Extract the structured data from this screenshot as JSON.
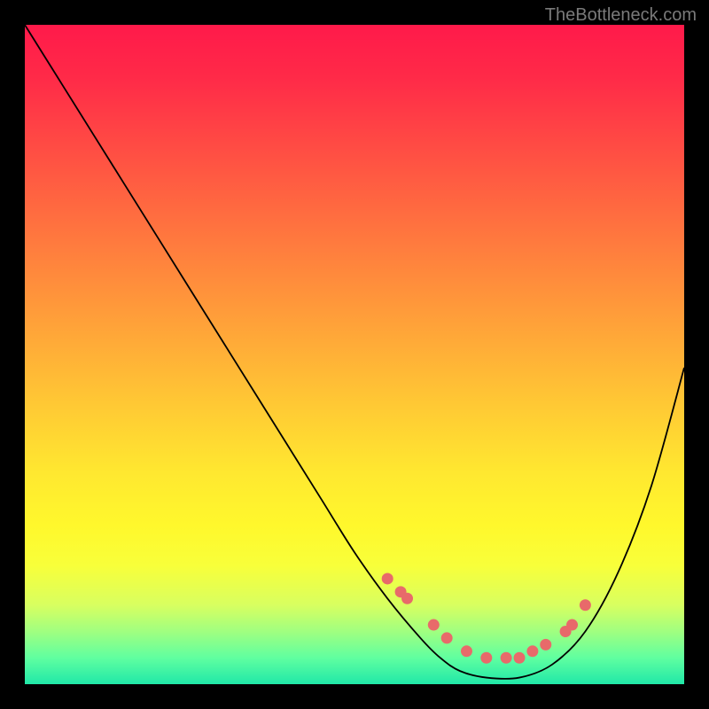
{
  "watermark": "TheBottleneck.com",
  "chart_data": {
    "type": "line",
    "title": "",
    "xlabel": "",
    "ylabel": "",
    "xlim": [
      0,
      100
    ],
    "ylim": [
      0,
      100
    ],
    "series": [
      {
        "name": "bottleneck-curve",
        "x": [
          0,
          5,
          10,
          15,
          20,
          25,
          30,
          35,
          40,
          45,
          50,
          55,
          60,
          63,
          66,
          70,
          75,
          80,
          85,
          90,
          95,
          100
        ],
        "y": [
          100,
          92,
          84,
          76,
          68,
          60,
          52,
          44,
          36,
          28,
          20,
          13,
          7,
          4,
          2,
          1,
          1,
          3,
          8,
          17,
          30,
          48
        ]
      }
    ],
    "highlight_points": {
      "name": "measured-dots",
      "x": [
        55,
        57,
        58,
        62,
        64,
        67,
        70,
        73,
        75,
        77,
        79,
        82,
        83,
        85
      ],
      "y": [
        16,
        14,
        13,
        9,
        7,
        5,
        4,
        4,
        4,
        5,
        6,
        8,
        9,
        12
      ]
    },
    "colors": {
      "curve": "#000000",
      "dots": "#e86a6a",
      "gradient_top": "#ff1a4a",
      "gradient_bottom": "#20e8a8"
    }
  }
}
